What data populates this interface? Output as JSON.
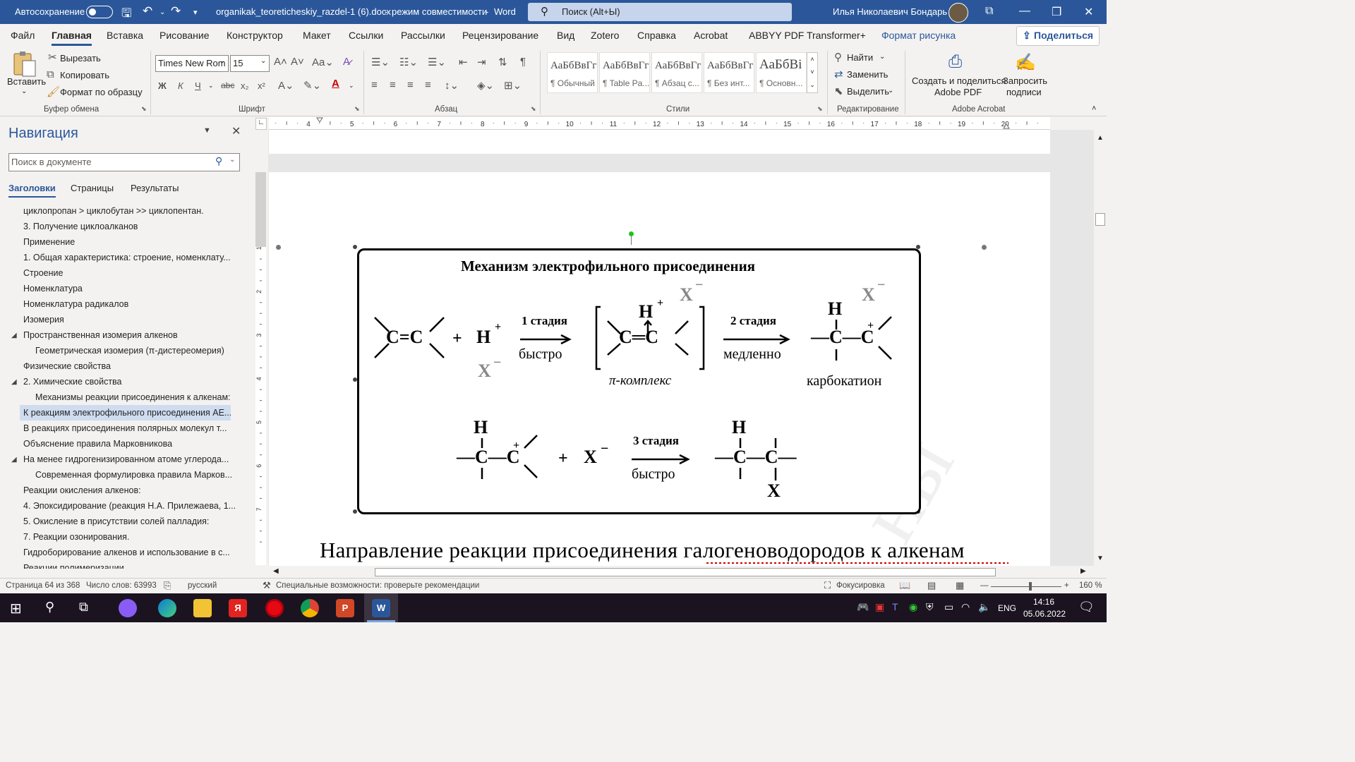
{
  "titlebar": {
    "autosave_label": "Автосохранение",
    "filename": "organikak_teoreticheskiy_razdel-1 (6).docx",
    "mode": "режим совместимости",
    "app": "Word",
    "search_placeholder": "Поиск (Alt+Ы)",
    "user": "Илья Николаевич Бондарь",
    "sep": "-"
  },
  "menu": {
    "tabs": [
      "Файл",
      "Главная",
      "Вставка",
      "Рисование",
      "Конструктор",
      "Макет",
      "Ссылки",
      "Рассылки",
      "Рецензирование",
      "Вид",
      "Zotero",
      "Справка",
      "Acrobat",
      "ABBYY PDF Transformer+",
      "Формат рисунка"
    ],
    "share": "Поделиться"
  },
  "ribbon": {
    "paste": "Вставить",
    "cut": "Вырезать",
    "copy": "Копировать",
    "format_painter": "Формат по образцу",
    "clipboard_group": "Буфер обмена",
    "font_name": "Times New Rom",
    "font_size": "15",
    "font_group": "Шрифт",
    "paragraph_group": "Абзац",
    "styles": [
      {
        "preview": "АаБбВвГг",
        "name": "¶ Обычный"
      },
      {
        "preview": "АаБбВвГг",
        "name": "¶ Table Pa..."
      },
      {
        "preview": "АаБбВвГг",
        "name": "¶ Абзац с..."
      },
      {
        "preview": "АаБбВвГг",
        "name": "¶ Без инт..."
      },
      {
        "preview": "АаБбВі",
        "name": "¶ Основн..."
      }
    ],
    "styles_group": "Стили",
    "find": "Найти",
    "replace": "Заменить",
    "select": "Выделить",
    "editing_group": "Редактирование",
    "create_pdf_1": "Создать и поделиться",
    "create_pdf_2": "Adobe PDF",
    "request_sign_1": "Запросить",
    "request_sign_2": "подписи",
    "acrobat_group": "Adobe Acrobat",
    "bold": "Ж",
    "italic": "К",
    "underline": "Ч",
    "strike": "abc",
    "sub": "x₂",
    "sup": "x²"
  },
  "nav": {
    "title": "Навигация",
    "search_placeholder": "Поиск в документе",
    "tabs": [
      "Заголовки",
      "Страницы",
      "Результаты"
    ],
    "items": [
      "циклопропан > циклобутан >> циклопентан.",
      "3. Получение циклоалканов",
      "Применение",
      "1.  Общая характеристика: строение, номенклату...",
      "Строение",
      "Номенклатура",
      "Номенклатура радикалов",
      "Изомерия",
      "Пространственная изомерия алкенов",
      "Геометрическая изомерия (π-дистереомерия)",
      "Физические свойства",
      "2.   Химические свойства",
      "Механизмы реакции присоединения к алкенам:",
      "К реакциям электрофильного присоединения АЕ...",
      "В реакциях присоединения полярных молекул т...",
      "Объяснение правила Марковникова",
      "На менее гидрогенизированном атоме углерода...",
      "Современная формулировка правила Марков...",
      "Реакции окисления алкенов:",
      "4. Эпоксидирование (реакция Н.А. Прилежаева, 1...",
      "5. Окисление в присутствии солей палладия:",
      "7. Реакции озонирования.",
      "Гидроборирование алкенов и использование в с...",
      "Реакции полимеризации"
    ]
  },
  "ruler": {
    "marks": [
      "4",
      "5",
      "6",
      "7",
      "8",
      "9",
      "10",
      "11",
      "12",
      "13",
      "14",
      "15",
      "16",
      "17",
      "18",
      "19",
      "20"
    ],
    "vmarks": [
      "1",
      "1",
      "2",
      "3",
      "4",
      "5",
      "6",
      "7"
    ]
  },
  "diagram": {
    "title": "Механизм электрофильного присоединения",
    "alkene": "C=C",
    "plus": "+",
    "h": "H",
    "charge_plus": "+",
    "x_minus": "X",
    "minus": "−",
    "stage1": "1 стадия",
    "fast": "быстро",
    "pi_h": "H",
    "pi_cc": "C═C",
    "pi_complex": "π-комплекс",
    "stage2": "2 стадия",
    "slow": "медленно",
    "carbocation_label": "карбокатион",
    "cation": "—C—C",
    "stage3": "3 стадия",
    "fast2": "быстро",
    "product": "—C—C—",
    "x": "X"
  },
  "doc": {
    "heading_line": "Направление  реакции  присоединения  галогеноводородов  к  алкенам",
    "watermark": "ны"
  },
  "status": {
    "page": "Страница 64 из 368",
    "words": "Число слов: 63993",
    "lang": "русский",
    "accessibility": "Специальные возможности: проверьте рекомендации",
    "focus": "Фокусировка",
    "zoom": "160 %"
  },
  "taskbar": {
    "lang": "ENG",
    "time": "14:16",
    "date": "05.06.2022"
  },
  "colors": {
    "accent": "#2b579a",
    "selection": "#cfdcf0"
  }
}
